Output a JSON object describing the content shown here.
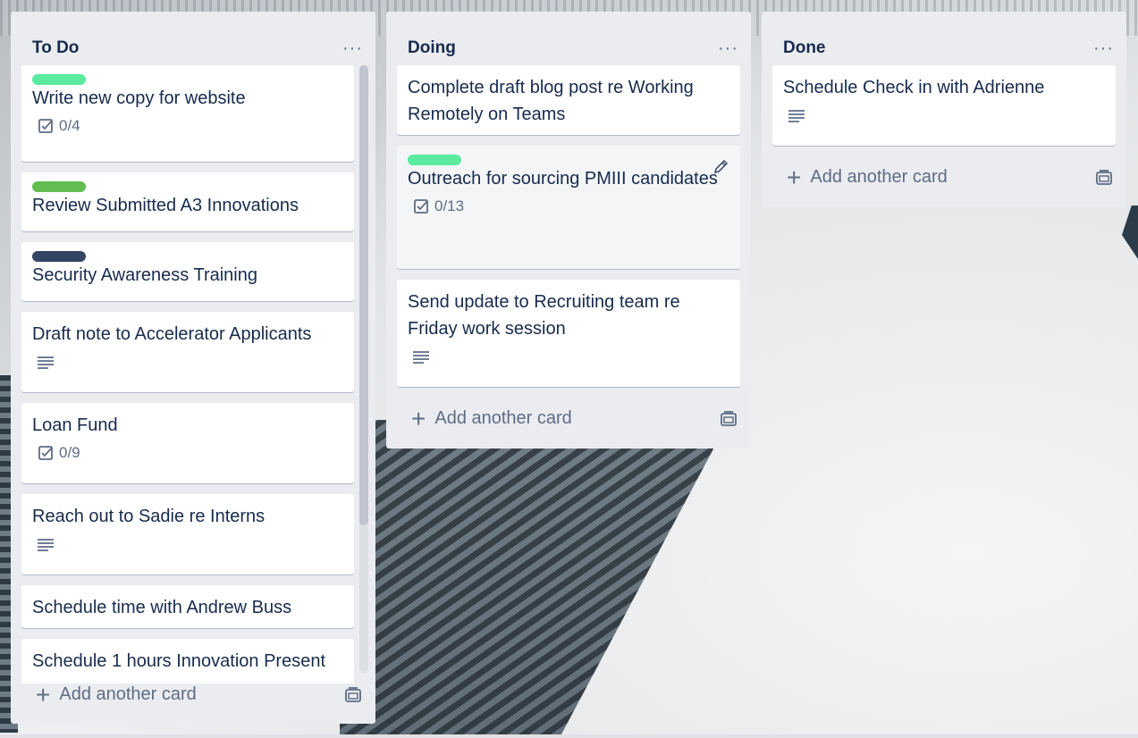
{
  "colors": {
    "label_green_light": "#5aeb9e",
    "label_green": "#61bd4f",
    "label_navy": "#344563"
  },
  "lists": [
    {
      "title": "To Do",
      "add_label": "Add another card",
      "cards": [
        {
          "title": "Write new copy for website",
          "label": "label_green_light",
          "checklist": "0/4"
        },
        {
          "title": "Review Submitted A3 Innovations",
          "label": "label_green"
        },
        {
          "title": "Security Awareness Training",
          "label": "label_navy"
        },
        {
          "title": "Draft note to Accelerator Applicants",
          "has_description": true
        },
        {
          "title": "Loan Fund",
          "checklist": "0/9"
        },
        {
          "title": "Reach out to Sadie re Interns",
          "has_description": true
        },
        {
          "title": "Schedule time with Andrew Buss"
        },
        {
          "title": "Schedule 1 hours Innovation Present"
        }
      ]
    },
    {
      "title": "Doing",
      "add_label": "Add another card",
      "cards": [
        {
          "title": "Complete draft blog post re Working Remotely on Teams"
        },
        {
          "title": "Outreach for sourcing PMIII candidates",
          "label": "label_green_light",
          "checklist": "0/13"
        },
        {
          "title": "Send update to Recruiting team re Friday work session",
          "has_description": true
        }
      ]
    },
    {
      "title": "Done",
      "add_label": "Add another card",
      "cards": [
        {
          "title": "Schedule Check in with Adrienne",
          "has_description": true
        }
      ]
    }
  ]
}
